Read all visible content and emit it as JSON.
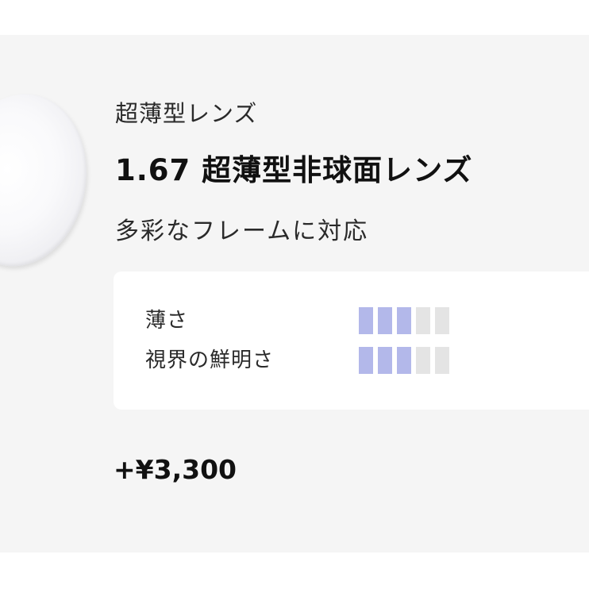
{
  "product": {
    "category": "超薄型レンズ",
    "name": "1.67 超薄型非球面レンズ",
    "subtitle": "多彩なフレームに対応",
    "price": "+¥3,300"
  },
  "specs": [
    {
      "label": "薄さ",
      "level": 3,
      "max": 5
    },
    {
      "label": "視界の鮮明さ",
      "level": 3,
      "max": 5
    }
  ],
  "colors": {
    "meter_on": "#b3b8ea",
    "meter_off": "#e4e4e4",
    "card_bg": "#f5f5f5"
  }
}
